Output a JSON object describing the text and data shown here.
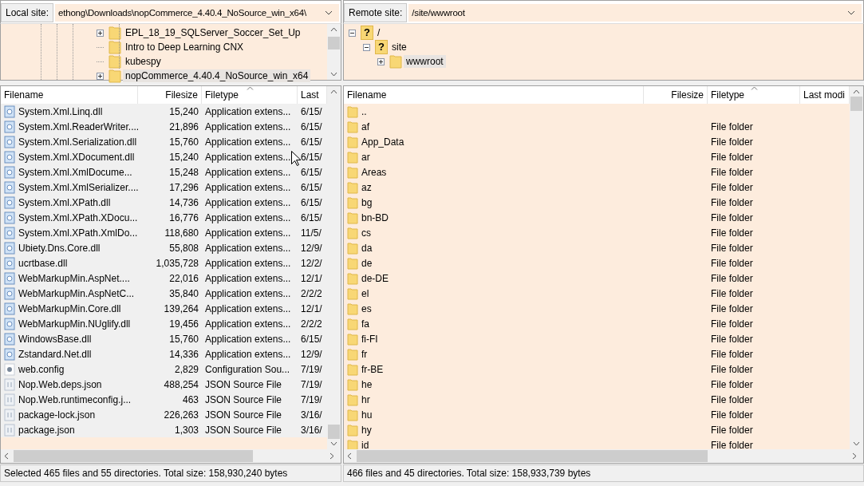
{
  "local": {
    "site_label": "Local site:",
    "path": "ethong\\Downloads\\nopCommerce_4.40.4_NoSource_win_x64\\",
    "tree": [
      {
        "name": "EPL_18_19_SQLServer_Soccer_Set_Up",
        "kind": "folder",
        "expanded": false,
        "selected": false
      },
      {
        "name": "Intro to Deep Learning CNX",
        "kind": "folder",
        "selected": false
      },
      {
        "name": "kubespy",
        "kind": "folder",
        "selected": false
      },
      {
        "name": "nopCommerce_4.40.4_NoSource_win_x64",
        "kind": "folder",
        "expanded": false,
        "selected": true
      }
    ],
    "columns": [
      {
        "label": "Filename",
        "sorted": false
      },
      {
        "label": "Filesize",
        "sorted": false
      },
      {
        "label": "Filetype",
        "sorted": true
      },
      {
        "label": "Last",
        "sorted": false
      }
    ],
    "rows": [
      {
        "name": "System.Xml.Linq.dll",
        "size": "15,240",
        "type": "Application extens...",
        "modified": "6/15/",
        "kind": "dll",
        "selected": true
      },
      {
        "name": "System.Xml.ReaderWriter....",
        "size": "21,896",
        "type": "Application extens...",
        "modified": "6/15/",
        "kind": "dll",
        "selected": true
      },
      {
        "name": "System.Xml.Serialization.dll",
        "size": "15,760",
        "type": "Application extens...",
        "modified": "6/15/",
        "kind": "dll",
        "selected": true
      },
      {
        "name": "System.Xml.XDocument.dll",
        "size": "15,240",
        "type": "Application extens...",
        "modified": "6/15/",
        "kind": "dll",
        "selected": true
      },
      {
        "name": "System.Xml.XmlDocume...",
        "size": "15,248",
        "type": "Application extens...",
        "modified": "6/15/",
        "kind": "dll",
        "selected": true
      },
      {
        "name": "System.Xml.XmlSerializer....",
        "size": "17,296",
        "type": "Application extens...",
        "modified": "6/15/",
        "kind": "dll",
        "selected": true
      },
      {
        "name": "System.Xml.XPath.dll",
        "size": "14,736",
        "type": "Application extens...",
        "modified": "6/15/",
        "kind": "dll",
        "selected": true
      },
      {
        "name": "System.Xml.XPath.XDocu...",
        "size": "16,776",
        "type": "Application extens...",
        "modified": "6/15/",
        "kind": "dll",
        "selected": true
      },
      {
        "name": "System.Xml.XPath.XmlDo...",
        "size": "118,680",
        "type": "Application extens...",
        "modified": "11/5/",
        "kind": "dll",
        "selected": true
      },
      {
        "name": "Ubiety.Dns.Core.dll",
        "size": "55,808",
        "type": "Application extens...",
        "modified": "12/9/",
        "kind": "dll",
        "selected": true
      },
      {
        "name": "ucrtbase.dll",
        "size": "1,035,728",
        "type": "Application extens...",
        "modified": "12/2/",
        "kind": "dll",
        "selected": true
      },
      {
        "name": "WebMarkupMin.AspNet....",
        "size": "22,016",
        "type": "Application extens...",
        "modified": "12/1/",
        "kind": "dll",
        "selected": true
      },
      {
        "name": "WebMarkupMin.AspNetC...",
        "size": "35,840",
        "type": "Application extens...",
        "modified": "2/2/2",
        "kind": "dll",
        "selected": true
      },
      {
        "name": "WebMarkupMin.Core.dll",
        "size": "139,264",
        "type": "Application extens...",
        "modified": "12/1/",
        "kind": "dll",
        "selected": true
      },
      {
        "name": "WebMarkupMin.NUglify.dll",
        "size": "19,456",
        "type": "Application extens...",
        "modified": "2/2/2",
        "kind": "dll",
        "selected": true
      },
      {
        "name": "WindowsBase.dll",
        "size": "15,760",
        "type": "Application extens...",
        "modified": "6/15/",
        "kind": "dll",
        "selected": true
      },
      {
        "name": "Zstandard.Net.dll",
        "size": "14,336",
        "type": "Application extens...",
        "modified": "12/9/",
        "kind": "dll",
        "selected": true
      },
      {
        "name": "web.config",
        "size": "2,829",
        "type": "Configuration Sou...",
        "modified": "7/19/",
        "kind": "config",
        "selected": true
      },
      {
        "name": "Nop.Web.deps.json",
        "size": "488,254",
        "type": "JSON Source File",
        "modified": "7/19/",
        "kind": "json",
        "selected": true
      },
      {
        "name": "Nop.Web.runtimeconfig.j...",
        "size": "463",
        "type": "JSON Source File",
        "modified": "7/19/",
        "kind": "json",
        "selected": true
      },
      {
        "name": "package-lock.json",
        "size": "226,263",
        "type": "JSON Source File",
        "modified": "3/16/",
        "kind": "json",
        "selected": true
      },
      {
        "name": "package.json",
        "size": "1,303",
        "type": "JSON Source File",
        "modified": "3/16/",
        "kind": "json",
        "selected": true
      }
    ],
    "status": "Selected 465 files and 55 directories. Total size: 158,930,240 bytes"
  },
  "remote": {
    "site_label": "Remote site:",
    "path": "/site/wwwroot",
    "tree": [
      {
        "name": "/",
        "kind": "unknown",
        "badge": "?",
        "expanded": true,
        "selected": false,
        "children": [
          {
            "name": "site",
            "kind": "unknown",
            "badge": "?",
            "expanded": true,
            "selected": false,
            "children": [
              {
                "name": "wwwroot",
                "kind": "folder",
                "expanded": false,
                "selected": true
              }
            ]
          }
        ]
      }
    ],
    "columns": [
      {
        "label": "Filename",
        "sorted": false
      },
      {
        "label": "Filesize",
        "sorted": false
      },
      {
        "label": "Filetype",
        "sorted": true
      },
      {
        "label": "Last modi",
        "sorted": false
      }
    ],
    "rows": [
      {
        "name": "..",
        "kind": "folder",
        "selected": false
      },
      {
        "name": "af",
        "type": "File folder",
        "kind": "folder",
        "selected": false
      },
      {
        "name": "App_Data",
        "type": "File folder",
        "kind": "folder",
        "selected": false
      },
      {
        "name": "ar",
        "type": "File folder",
        "kind": "folder",
        "selected": false
      },
      {
        "name": "Areas",
        "type": "File folder",
        "kind": "folder",
        "selected": false
      },
      {
        "name": "az",
        "type": "File folder",
        "kind": "folder",
        "selected": false
      },
      {
        "name": "bg",
        "type": "File folder",
        "kind": "folder",
        "selected": false
      },
      {
        "name": "bn-BD",
        "type": "File folder",
        "kind": "folder",
        "selected": false
      },
      {
        "name": "cs",
        "type": "File folder",
        "kind": "folder",
        "selected": false
      },
      {
        "name": "da",
        "type": "File folder",
        "kind": "folder",
        "selected": false
      },
      {
        "name": "de",
        "type": "File folder",
        "kind": "folder",
        "selected": false
      },
      {
        "name": "de-DE",
        "type": "File folder",
        "kind": "folder",
        "selected": false
      },
      {
        "name": "el",
        "type": "File folder",
        "kind": "folder",
        "selected": false
      },
      {
        "name": "es",
        "type": "File folder",
        "kind": "folder",
        "selected": false
      },
      {
        "name": "fa",
        "type": "File folder",
        "kind": "folder",
        "selected": false
      },
      {
        "name": "fi-FI",
        "type": "File folder",
        "kind": "folder",
        "selected": false
      },
      {
        "name": "fr",
        "type": "File folder",
        "kind": "folder",
        "selected": false
      },
      {
        "name": "fr-BE",
        "type": "File folder",
        "kind": "folder",
        "selected": false
      },
      {
        "name": "he",
        "type": "File folder",
        "kind": "folder",
        "selected": false
      },
      {
        "name": "hr",
        "type": "File folder",
        "kind": "folder",
        "selected": false
      },
      {
        "name": "hu",
        "type": "File folder",
        "kind": "folder",
        "selected": false
      },
      {
        "name": "hy",
        "type": "File folder",
        "kind": "folder",
        "selected": false
      },
      {
        "name": "id",
        "type": "File folder",
        "kind": "folder",
        "selected": false
      }
    ],
    "status": "466 files and 45 directories. Total size: 158,933,739 bytes"
  }
}
